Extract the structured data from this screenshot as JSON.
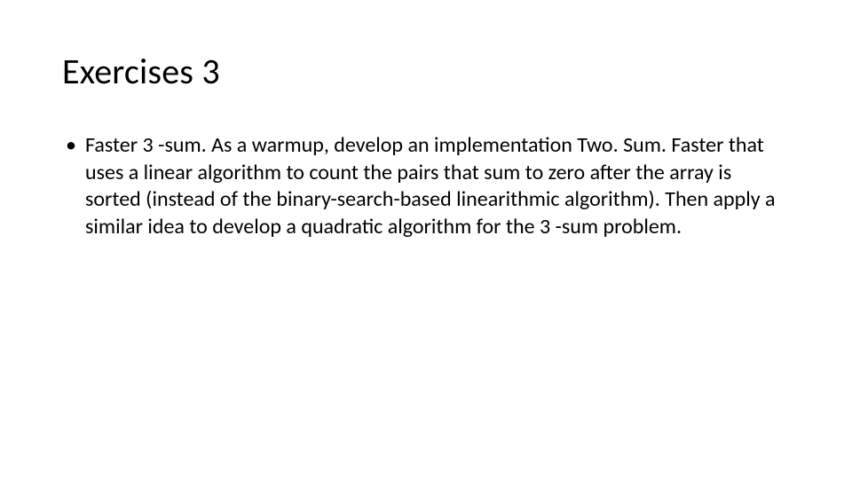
{
  "slide": {
    "title": "Exercises 3",
    "bullets": [
      "Faster 3 -sum. As a warmup, develop an implementation Two. Sum. Faster that uses a linear algorithm to count the pairs that sum to zero after the array is sorted (instead of the binary-search-based linearithmic algorithm). Then apply a similar idea to develop a quadratic algorithm for the 3 -sum problem."
    ]
  }
}
